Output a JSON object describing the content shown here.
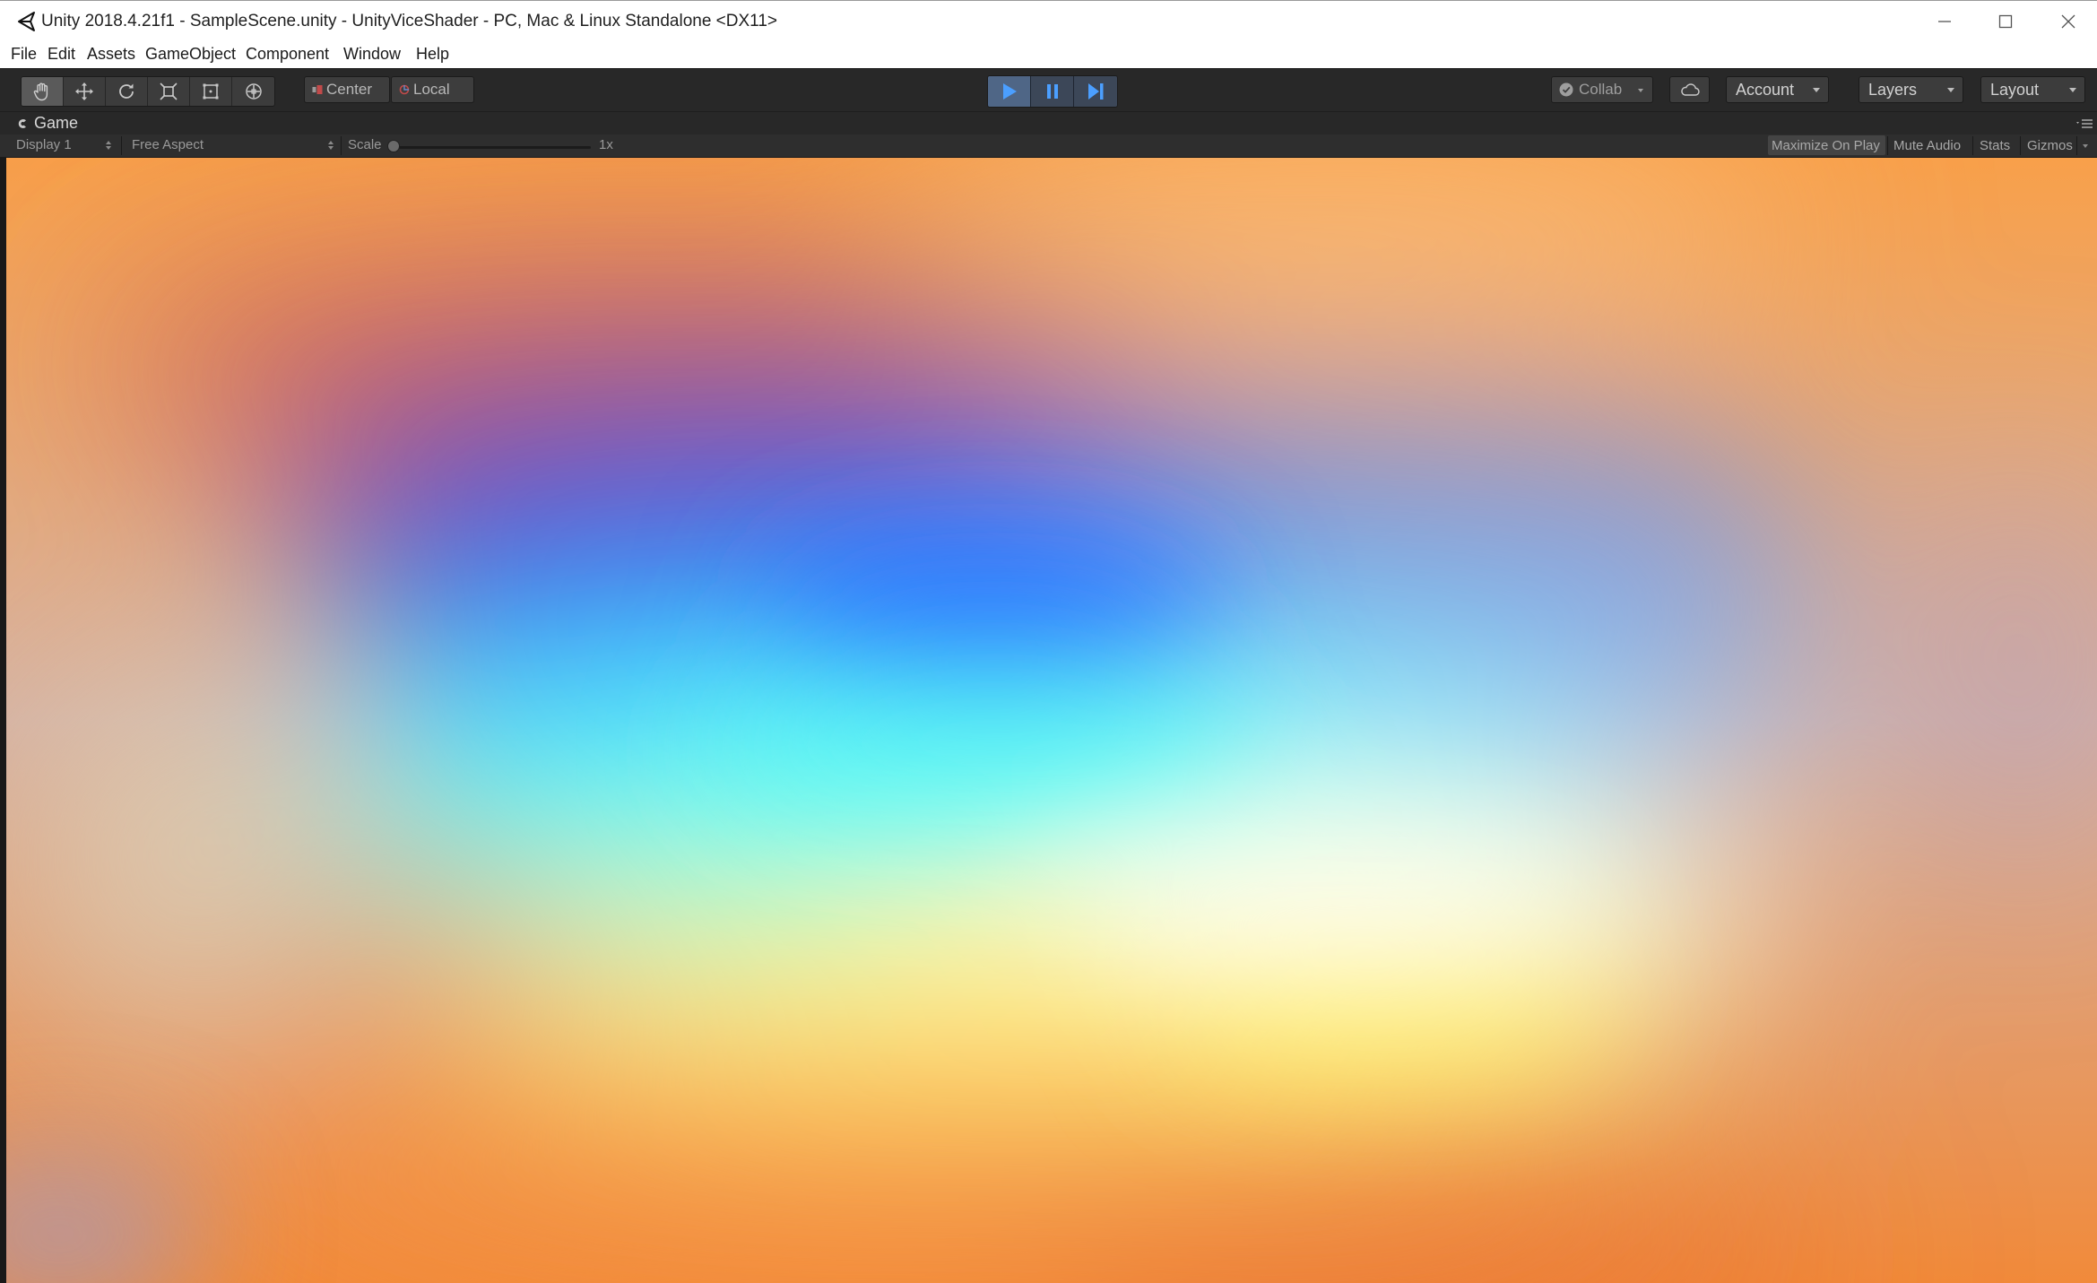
{
  "window": {
    "title": "Unity 2018.4.21f1 - SampleScene.unity - UnityViceShader - PC, Mac & Linux Standalone <DX11>",
    "controls": [
      "minimize-icon",
      "maximize-icon",
      "close-icon"
    ]
  },
  "menu": {
    "items": [
      "File",
      "Edit",
      "Assets",
      "GameObject",
      "Component",
      "Window",
      "Help"
    ]
  },
  "toolbar": {
    "tools": [
      "hand-tool-icon",
      "move-tool-icon",
      "rotate-tool-icon",
      "scale-tool-icon",
      "rect-tool-icon",
      "transform-tool-icon"
    ],
    "active_tool": "hand-tool-icon",
    "pivot_label": "Center",
    "rotation_label": "Local",
    "play_controls": [
      "play-icon",
      "pause-icon",
      "step-icon"
    ],
    "playing": true,
    "collab_label": "Collab",
    "account_label": "Account",
    "layers_label": "Layers",
    "layout_label": "Layout",
    "colors": {
      "play_active": "#4f6686",
      "play_icon": "#4b9fff"
    }
  },
  "game_tab": {
    "label": "Game"
  },
  "game_bar": {
    "display_label": "Display 1",
    "aspect_label": "Free Aspect",
    "scale_label": "Scale",
    "scale_value": "1x",
    "scale_fraction": 0.0,
    "maximize_on_play_label": "Maximize On Play",
    "maximize_on_play_active": true,
    "mute_audio_label": "Mute Audio",
    "stats_label": "Stats",
    "gizmos_label": "Gizmos"
  },
  "game_view": {
    "content": "shader-gradient",
    "colors": {
      "orange": "#f7913c",
      "purple": "#5a4ca8",
      "blue": "#2d72ff",
      "cyan": "#5ffff6",
      "white": "#f9fffd",
      "yellow": "#fff57a"
    }
  }
}
